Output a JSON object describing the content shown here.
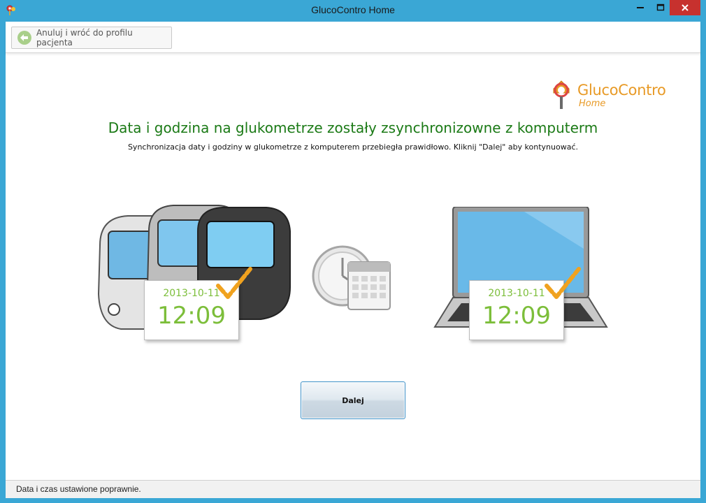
{
  "window": {
    "title": "GlucoContro Home"
  },
  "toolbar": {
    "back_label": "Anuluj i wróć do profilu pacjenta"
  },
  "logo": {
    "main": "GlucoContro",
    "sub": "Home"
  },
  "content": {
    "heading": "Data i godzina na glukometrze zostały zsynchronizowne z komputerm",
    "subheading": "Synchronizacja daty i godziny w glukometrze z komputerem przebiegła prawidłowo. Kliknij \"Dalej\" aby kontynuować.",
    "meter_card": {
      "date": "2013-10-11",
      "time": "12:09"
    },
    "computer_card": {
      "date": "2013-10-11",
      "time": "12:09"
    },
    "next_label": "Dalej"
  },
  "status": {
    "text": "Data i czas ustawione poprawnie."
  },
  "colors": {
    "accent": "#3aa7d5",
    "heading": "#1b7a16",
    "card_text": "#7cbe3a",
    "logo": "#e89a26",
    "close": "#c7312e"
  }
}
